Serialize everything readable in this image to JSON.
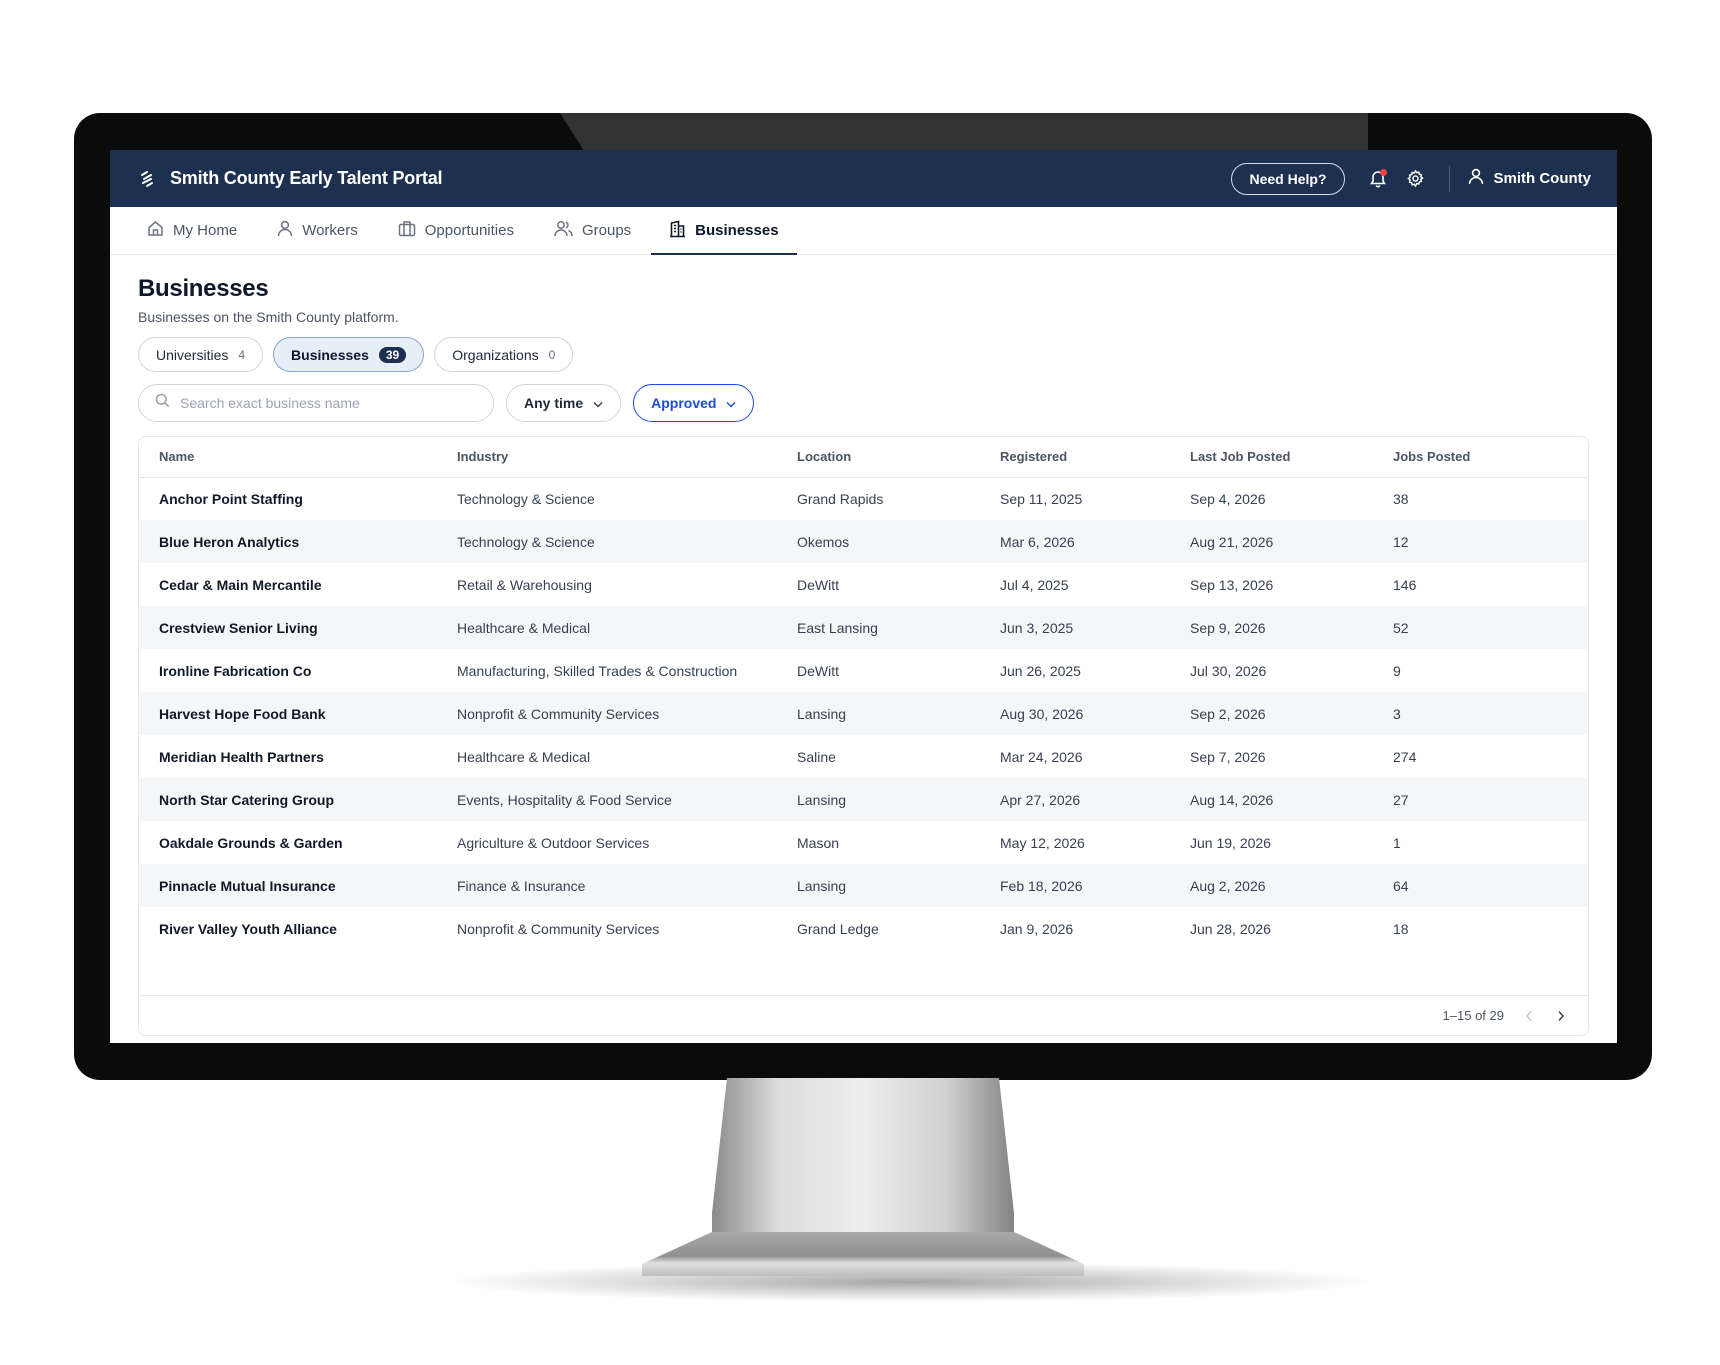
{
  "app": {
    "title": "Smith County Early Talent Portal"
  },
  "topbar": {
    "help_label": "Need Help?",
    "account_name": "Smith County"
  },
  "nav": {
    "items": [
      {
        "label": "My Home",
        "icon": "home-icon"
      },
      {
        "label": "Workers",
        "icon": "user-icon"
      },
      {
        "label": "Opportunities",
        "icon": "briefcase-icon"
      },
      {
        "label": "Groups",
        "icon": "users-icon"
      },
      {
        "label": "Businesses",
        "icon": "building-icon",
        "active": true
      }
    ]
  },
  "page": {
    "title": "Businesses",
    "subtitle": "Businesses on the Smith County platform."
  },
  "segments": [
    {
      "label": "Universities",
      "count": "4"
    },
    {
      "label": "Businesses",
      "count": "39",
      "active": true
    },
    {
      "label": "Organizations",
      "count": "0"
    }
  ],
  "filters": {
    "search_placeholder": "Search exact business name",
    "time_label": "Any time",
    "status_label": "Approved"
  },
  "table": {
    "columns": [
      "Name",
      "Industry",
      "Location",
      "Registered",
      "Last Job Posted",
      "Jobs Posted"
    ],
    "rows": [
      [
        "Anchor Point Staffing",
        "Technology & Science",
        "Grand Rapids",
        "Sep 11, 2025",
        "Sep 4, 2026",
        "38"
      ],
      [
        "Blue Heron Analytics",
        "Technology & Science",
        "Okemos",
        "Mar 6, 2026",
        "Aug 21, 2026",
        "12"
      ],
      [
        "Cedar & Main Mercantile",
        "Retail & Warehousing",
        "DeWitt",
        "Jul 4, 2025",
        "Sep 13, 2026",
        "146"
      ],
      [
        "Crestview Senior Living",
        "Healthcare & Medical",
        "East Lansing",
        "Jun 3, 2025",
        "Sep 9, 2026",
        "52"
      ],
      [
        "Ironline Fabrication Co",
        "Manufacturing, Skilled Trades & Construction",
        "DeWitt",
        "Jun 26, 2025",
        "Jul 30, 2026",
        "9"
      ],
      [
        "Harvest Hope Food Bank",
        "Nonprofit & Community Services",
        "Lansing",
        "Aug 30, 2026",
        "Sep 2, 2026",
        "3"
      ],
      [
        "Meridian Health Partners",
        "Healthcare & Medical",
        "Saline",
        "Mar 24, 2026",
        "Sep 7, 2026",
        "274"
      ],
      [
        "North Star Catering Group",
        "Events, Hospitality & Food Service",
        "Lansing",
        "Apr 27, 2026",
        "Aug 14, 2026",
        "27"
      ],
      [
        "Oakdale Grounds & Garden",
        "Agriculture & Outdoor Services",
        "Mason",
        "May 12, 2026",
        "Jun 19, 2026",
        "1"
      ],
      [
        "Pinnacle Mutual Insurance",
        "Finance & Insurance",
        "Lansing",
        "Feb 18, 2026",
        "Aug 2, 2026",
        "64"
      ],
      [
        "River Valley Youth Alliance",
        "Nonprofit & Community Services",
        "Grand Ledge",
        "Jan 9, 2026",
        "Jun 28, 2026",
        "18"
      ]
    ],
    "pagination": "1–15 of 29"
  },
  "colors": {
    "topbar": "#1e3050",
    "accent": "#1d4ed8",
    "notification": "#ef4444"
  }
}
